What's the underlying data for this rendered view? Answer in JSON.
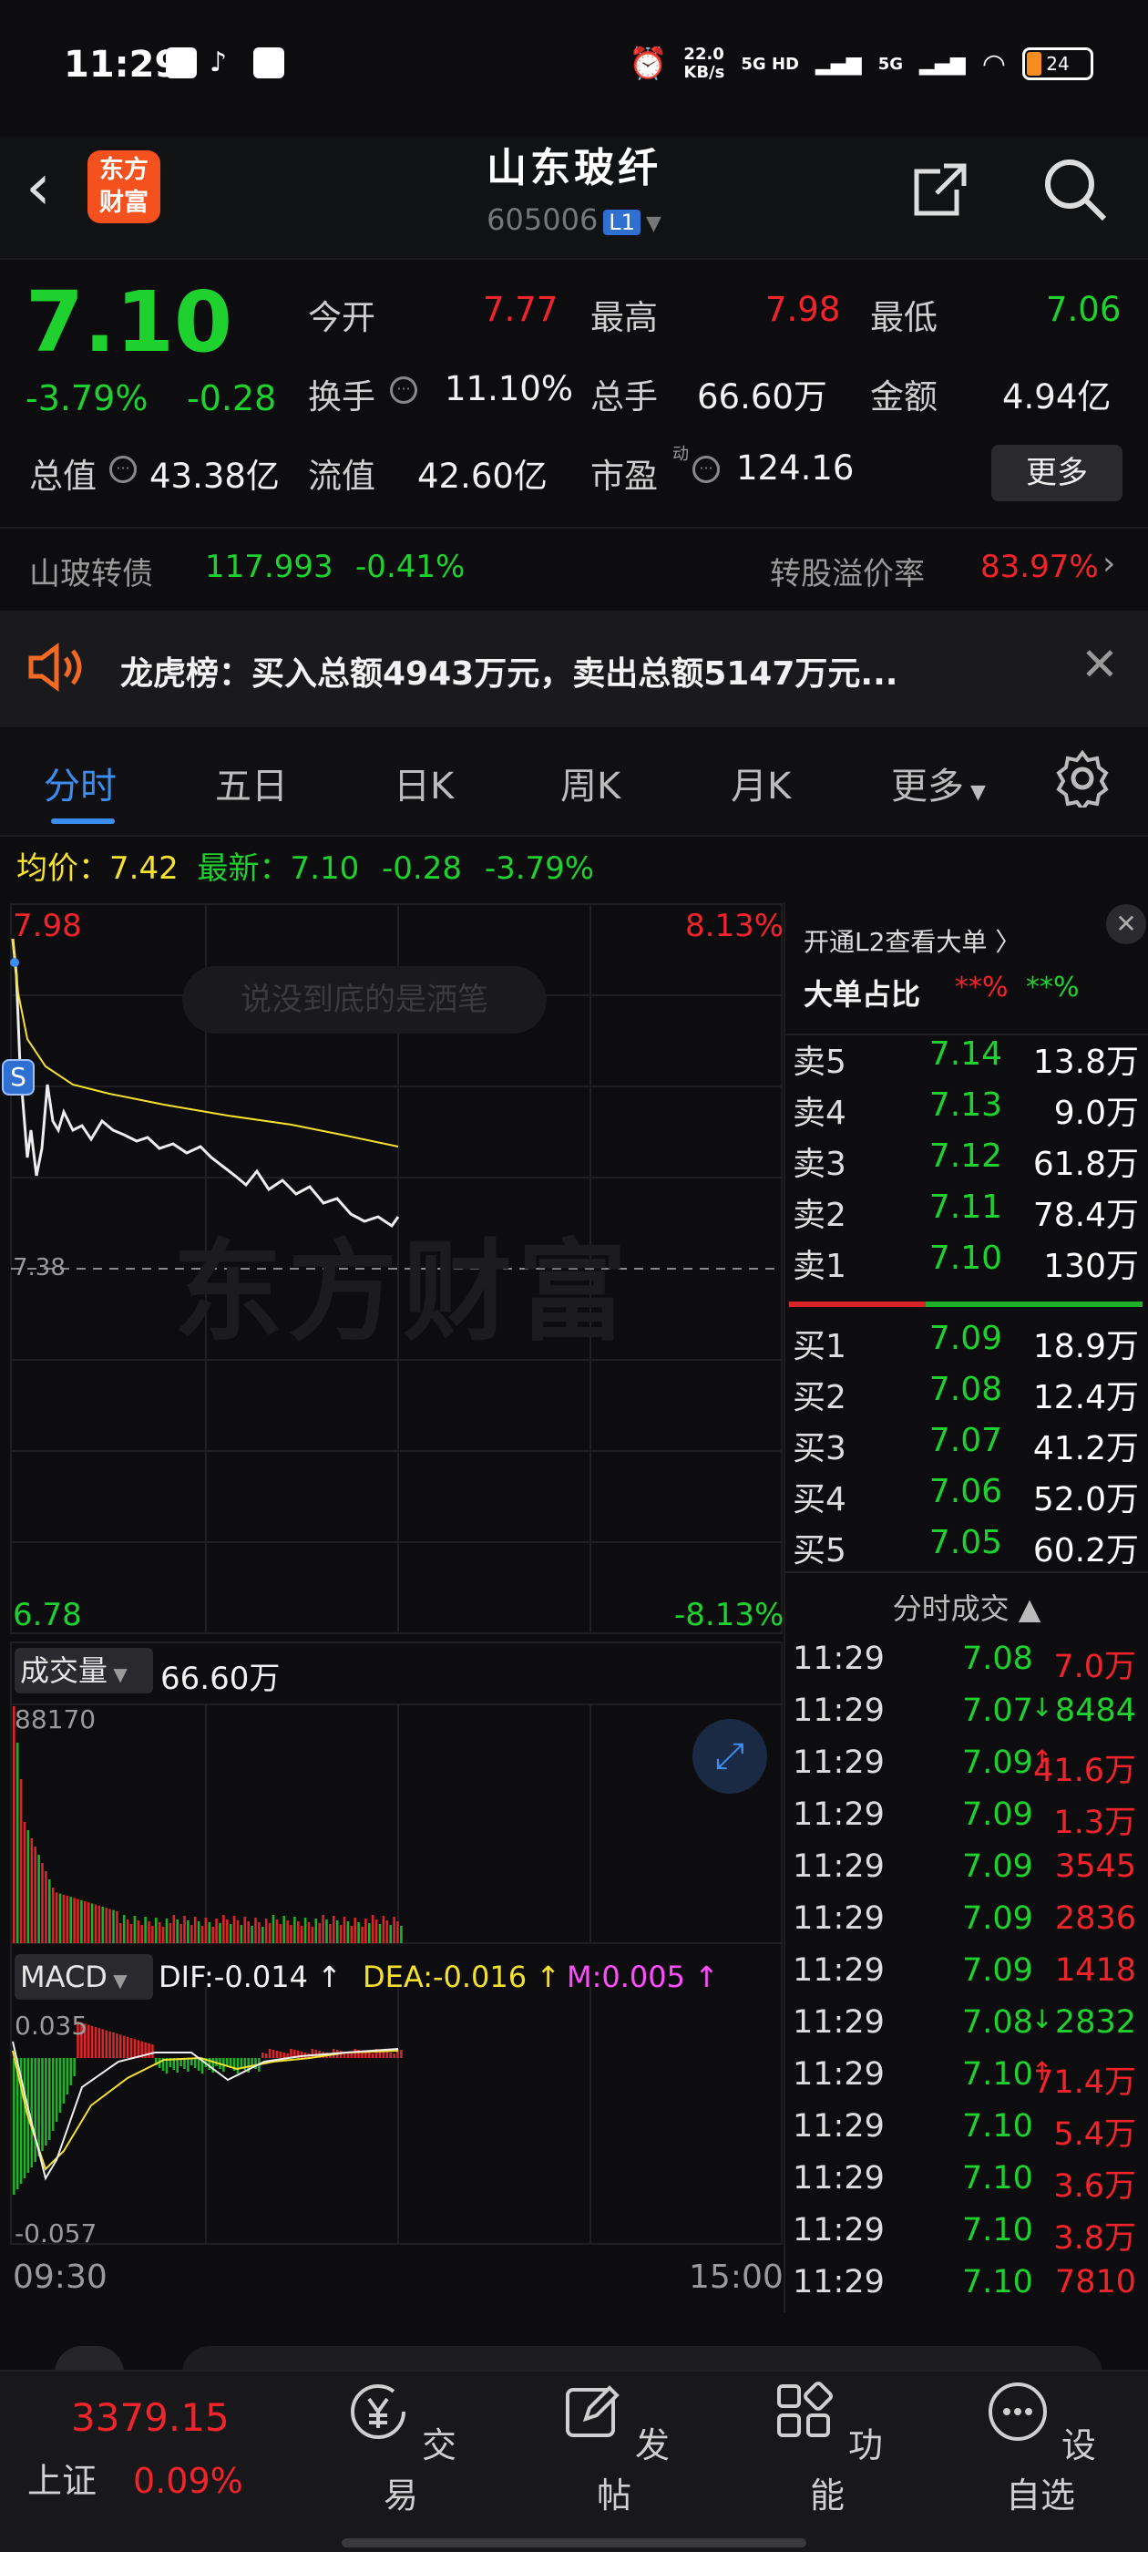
{
  "status_bar": {
    "time": "11:29",
    "net_speed": "22.0",
    "net_unit": "KB/s",
    "sig1": "5G HD",
    "sig2": "5G",
    "battery": "24"
  },
  "header": {
    "title": "山东玻纤",
    "code": "605006",
    "badge": "L1",
    "logo_line1": "东方",
    "logo_line2": "财富"
  },
  "quote": {
    "price": "7.10",
    "change_pct": "-3.79%",
    "change": "-0.28",
    "open_label": "今开",
    "open": "7.77",
    "high_label": "最高",
    "high": "7.98",
    "low_label": "最低",
    "low": "7.06",
    "turnover_label": "换手",
    "turnover": "11.10%",
    "volume_label": "总手",
    "volume": "66.60万",
    "amount_label": "金额",
    "amount": "4.94亿",
    "mcap_label": "总值",
    "mcap": "43.38亿",
    "float_label": "流值",
    "float_cap": "42.60亿",
    "pe_label": "市盈",
    "pe_sup": "动",
    "pe": "124.16",
    "more": "更多"
  },
  "bond": {
    "name": "山玻转债",
    "price": "117.993",
    "chg": "-0.41%",
    "premium_label": "转股溢价率",
    "premium": "83.97%"
  },
  "notice": {
    "text": "龙虎榜：买入总额4943万元，卖出总额5147万元..."
  },
  "tabs": [
    "分时",
    "五日",
    "日K",
    "周K",
    "月K",
    "更多"
  ],
  "avg_bar": {
    "avg_label": "均价：",
    "avg": "7.42",
    "latest_label": "最新：",
    "latest": "7.10",
    "chg": "-0.28",
    "pct": "-3.79%"
  },
  "chart": {
    "y_max": "7.98",
    "y_min": "6.78",
    "pct_max": "8.13%",
    "pct_min": "-8.13%",
    "prev_close": "7.38",
    "watermark": "说没到底的是洒笔",
    "brand_watermark": "东方财富",
    "s_marker": "S"
  },
  "volume_panel": {
    "label": "成交量",
    "value": "66.60万",
    "max": "88170"
  },
  "macd_panel": {
    "label": "MACD",
    "dif": "DIF:-0.014 ↑",
    "dea": "DEA:-0.016 ↑",
    "m": "M:0.005 ↑",
    "top": "0.035",
    "bottom": "-0.057"
  },
  "time_axis": {
    "start": "09:30",
    "end": "15:00"
  },
  "order_book": {
    "l2_text": "开通L2查看大单 〉",
    "big_label": "大单占比",
    "big_red": "**%",
    "big_green": "**%",
    "asks": [
      {
        "l": "卖5",
        "p": "7.14",
        "v": "13.8万"
      },
      {
        "l": "卖4",
        "p": "7.13",
        "v": "9.0万"
      },
      {
        "l": "卖3",
        "p": "7.12",
        "v": "61.8万"
      },
      {
        "l": "卖2",
        "p": "7.11",
        "v": "78.4万"
      },
      {
        "l": "卖1",
        "p": "7.10",
        "v": "130万"
      }
    ],
    "bids": [
      {
        "l": "买1",
        "p": "7.09",
        "v": "18.9万"
      },
      {
        "l": "买2",
        "p": "7.08",
        "v": "12.4万"
      },
      {
        "l": "买3",
        "p": "7.07",
        "v": "41.2万"
      },
      {
        "l": "买4",
        "p": "7.06",
        "v": "52.0万"
      },
      {
        "l": "买5",
        "p": "7.05",
        "v": "60.2万"
      }
    ]
  },
  "ticks": {
    "title": "分时成交",
    "rows": [
      {
        "t": "11:29",
        "p": "7.08",
        "arrow": "",
        "v": "7.0万",
        "vc": "red"
      },
      {
        "t": "11:29",
        "p": "7.07",
        "arrow": "↓",
        "v": "8484",
        "vc": "green"
      },
      {
        "t": "11:29",
        "p": "7.09",
        "arrow": "↑",
        "v": "41.6万",
        "vc": "red"
      },
      {
        "t": "11:29",
        "p": "7.09",
        "arrow": "",
        "v": "1.3万",
        "vc": "red"
      },
      {
        "t": "11:29",
        "p": "7.09",
        "arrow": "",
        "v": "3545",
        "vc": "red"
      },
      {
        "t": "11:29",
        "p": "7.09",
        "arrow": "",
        "v": "2836",
        "vc": "red"
      },
      {
        "t": "11:29",
        "p": "7.09",
        "arrow": "",
        "v": "1418",
        "vc": "red"
      },
      {
        "t": "11:29",
        "p": "7.08",
        "arrow": "↓",
        "v": "2832",
        "vc": "green"
      },
      {
        "t": "11:29",
        "p": "7.10",
        "arrow": "↑",
        "v": "71.4万",
        "vc": "red"
      },
      {
        "t": "11:29",
        "p": "7.10",
        "arrow": "",
        "v": "5.4万",
        "vc": "red"
      },
      {
        "t": "11:29",
        "p": "7.10",
        "arrow": "",
        "v": "3.6万",
        "vc": "red"
      },
      {
        "t": "11:29",
        "p": "7.10",
        "arrow": "",
        "v": "3.8万",
        "vc": "red"
      },
      {
        "t": "11:29",
        "p": "7.10",
        "arrow": "",
        "v": "7810",
        "vc": "red"
      }
    ]
  },
  "bottom_nav": {
    "index_value": "3379.15",
    "index_name": "上证",
    "index_pct": "0.09%",
    "items": [
      "交易",
      "发帖",
      "功能",
      "设自选"
    ]
  },
  "colors": {
    "up": "#f0242a",
    "down": "#1fd12f",
    "accent": "#3b8df2",
    "avg": "#f5e12e"
  }
}
